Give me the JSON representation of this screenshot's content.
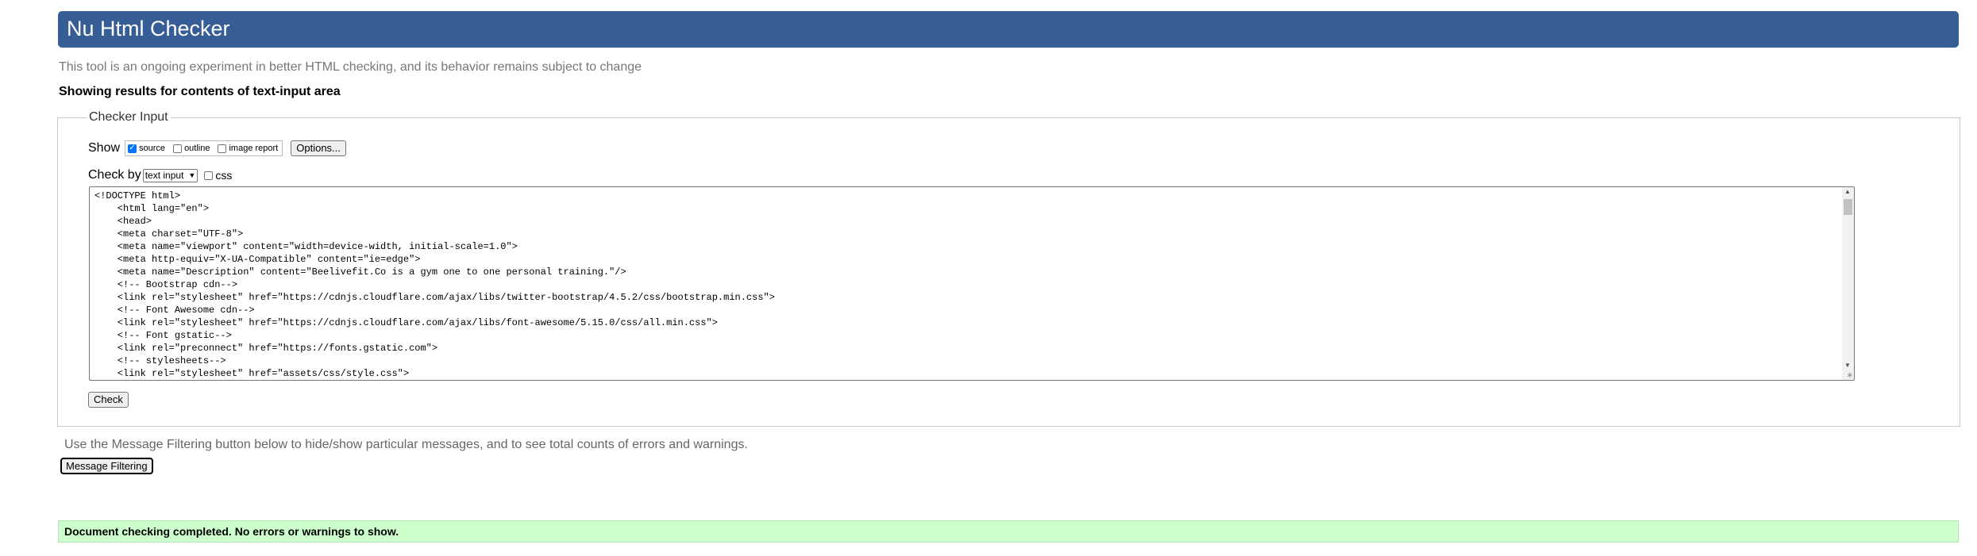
{
  "header": {
    "title": "Nu Html Checker"
  },
  "tagline": "This tool is an ongoing experiment in better HTML checking, and its behavior remains subject to change",
  "results_heading": "Showing results for contents of text-input area",
  "checker": {
    "legend": "Checker Input",
    "show_label": "Show",
    "show_options": [
      {
        "label": "source",
        "checked": true
      },
      {
        "label": "outline",
        "checked": false
      },
      {
        "label": "image report",
        "checked": false
      }
    ],
    "options_button": "Options...",
    "check_by_label": "Check by",
    "check_by_value": "text input",
    "css_label": "css",
    "css_checked": false,
    "source_lines": [
      "<!DOCTYPE html>",
      "    <html lang=\"en\">",
      "    <head>",
      "    <meta charset=\"UTF-8\">",
      "    <meta name=\"viewport\" content=\"width=device-width, initial-scale=1.0\">",
      "    <meta http-equiv=\"X-UA-Compatible\" content=\"ie=edge\">",
      "    <meta name=\"Description\" content=\"Beelivefit.Co is a gym one to one personal training.\"/>",
      "    <!-- Bootstrap cdn-->",
      "    <link rel=\"stylesheet\" href=\"https://cdnjs.cloudflare.com/ajax/libs/twitter-bootstrap/4.5.2/css/bootstrap.min.css\">",
      "    <!-- Font Awesome cdn-->",
      "    <link rel=\"stylesheet\" href=\"https://cdnjs.cloudflare.com/ajax/libs/font-awesome/5.15.0/css/all.min.css\">",
      "    <!-- Font gstatic-->",
      "    <link rel=\"preconnect\" href=\"https://fonts.gstatic.com\">",
      "    <!-- stylesheets-->",
      "    <link rel=\"stylesheet\" href=\"assets/css/style.css\">"
    ],
    "check_button": "Check"
  },
  "filter_note": "Use the Message Filtering button below to hide/show particular messages, and to see total counts of errors and warnings.",
  "filter_button": "Message Filtering",
  "success_message": "Document checking completed. No errors or warnings to show.",
  "colors": {
    "header_bg": "#365d95",
    "success_bg": "#ccffcc",
    "checkbox_accent": "#0075ff"
  }
}
